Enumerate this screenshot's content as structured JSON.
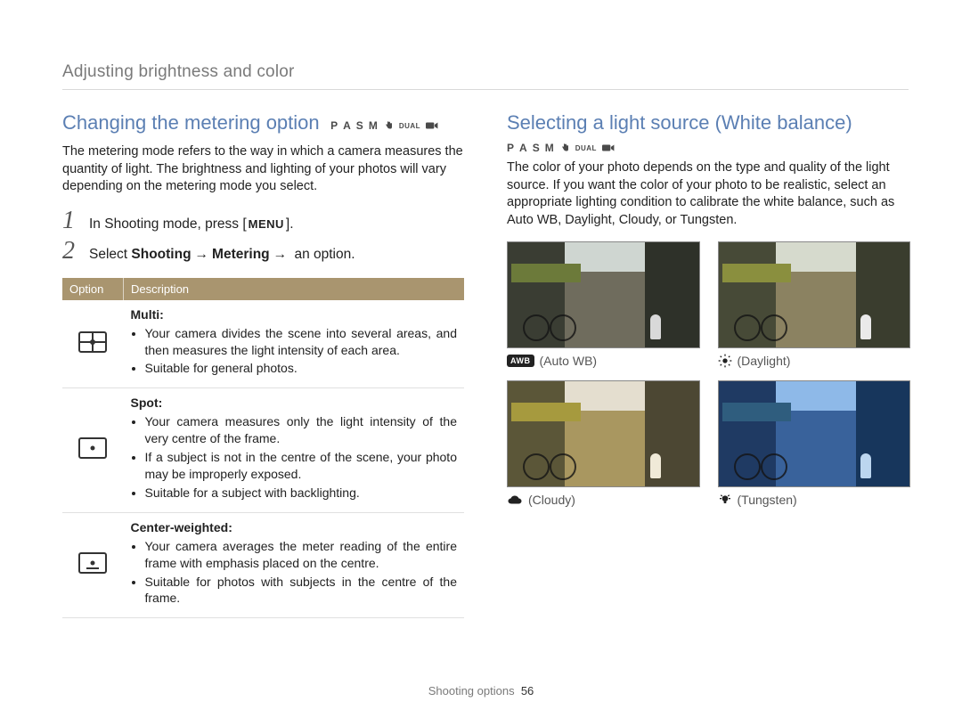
{
  "header": "Adjusting brightness and color",
  "left": {
    "title": "Changing the metering option",
    "modes": [
      "P",
      "A",
      "S",
      "M",
      "DUAL"
    ],
    "intro": "The metering mode refers to the way in which a camera measures the quantity of light. The brightness and lighting of your photos will vary depending on the metering mode you select.",
    "step1_pre": "In Shooting mode, press [",
    "step1_menu": "MENU",
    "step1_post": "].",
    "step2_pre": "Select ",
    "step2_b1": "Shooting",
    "step2_arrow": "→",
    "step2_b2": "Metering",
    "step2_post": " an option.",
    "table": {
      "header_option": "Option",
      "header_desc": "Description",
      "rows": [
        {
          "name": "Multi",
          "name_suffix": ":",
          "bullets": [
            "Your camera divides the scene into several areas, and then measures the light intensity of each area.",
            "Suitable for general photos."
          ]
        },
        {
          "name": "Spot",
          "name_suffix": ":",
          "bullets": [
            "Your camera measures only the light intensity of the very centre of the frame.",
            "If a subject is not in the centre of the scene, your photo may be improperly exposed.",
            "Suitable for a subject with backlighting."
          ]
        },
        {
          "name": "Center-weighted",
          "name_suffix": ":",
          "bullets": [
            "Your camera averages the meter reading of the entire frame with emphasis placed on the centre.",
            "Suitable for photos with subjects in the centre of the frame."
          ]
        }
      ]
    }
  },
  "right": {
    "title": "Selecting a light source (White balance)",
    "modes": [
      "P",
      "A",
      "S",
      "M",
      "DUAL"
    ],
    "intro": "The color of your photo depends on the type and quality of the light source. If you want the color of your photo to be realistic, select an appropriate lighting condition to calibrate the white balance, such as Auto WB, Daylight, Cloudy, or Tungsten.",
    "samples": [
      {
        "label": "(Auto WB)",
        "icon": "awb",
        "tint": "tint-auto"
      },
      {
        "label": "(Daylight)",
        "icon": "sun",
        "tint": "tint-day"
      },
      {
        "label": "(Cloudy)",
        "icon": "cloud",
        "tint": "tint-cloud"
      },
      {
        "label": "(Tungsten)",
        "icon": "bulb",
        "tint": "tint-tung"
      }
    ]
  },
  "footer": {
    "section": "Shooting options",
    "page": "56"
  }
}
